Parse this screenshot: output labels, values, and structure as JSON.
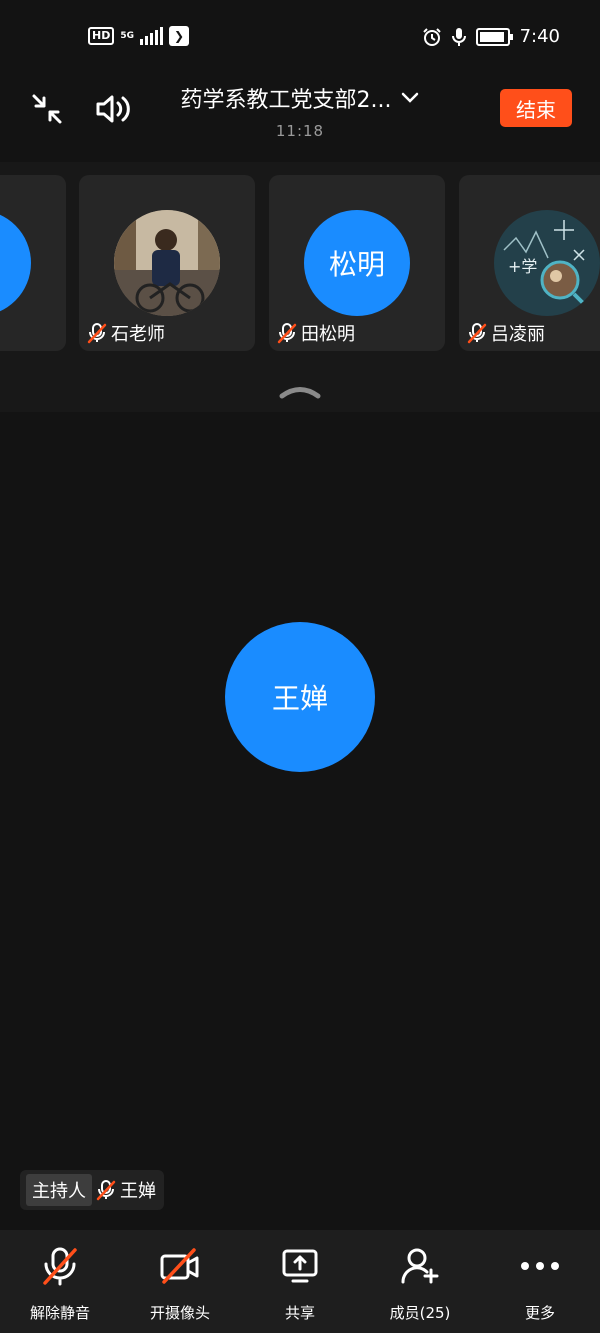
{
  "status_bar": {
    "network_badge": "HD",
    "signal_type": "5G",
    "time": "7:40"
  },
  "header": {
    "title": "药学系教工党支部2...",
    "duration": "11:18",
    "end_label": "结束"
  },
  "participants": [
    {
      "name": "石老师",
      "avatar_type": "photo",
      "muted": true
    },
    {
      "name": "田松明",
      "avatar_text": "松明",
      "avatar_type": "initials",
      "muted": true
    },
    {
      "name": "吕凌丽",
      "avatar_type": "photo",
      "muted": true
    }
  ],
  "speaker": {
    "avatar_text": "王婵",
    "role": "主持人",
    "name": "王婵"
  },
  "toolbar": {
    "unmute": "解除静音",
    "camera": "开摄像头",
    "share": "共享",
    "members": "成员(25)",
    "more": "更多"
  },
  "colors": {
    "accent_blue": "#1a8cff",
    "end_red": "#ff4f1a",
    "mute_red": "#ff4f1a",
    "background": "#131313"
  }
}
